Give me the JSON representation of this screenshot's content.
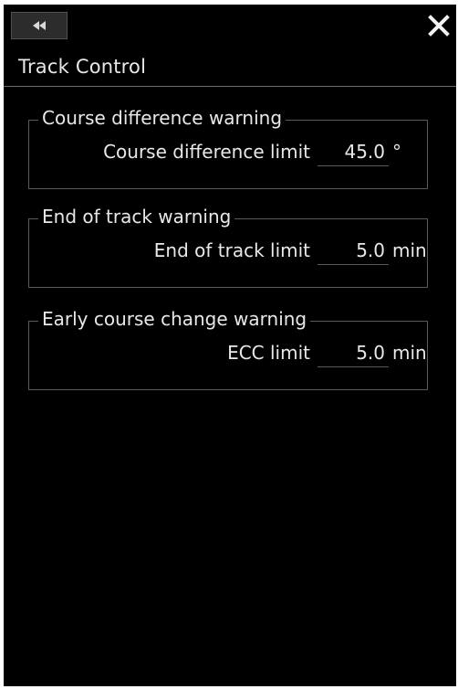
{
  "header": {
    "collapse_icon": "double-chevron-left-icon",
    "close_icon": "close-icon"
  },
  "panel": {
    "title": "Track Control"
  },
  "groups": [
    {
      "title": "Course difference warning",
      "field_label": "Course difference limit",
      "value": "45.0",
      "unit": "°"
    },
    {
      "title": "End of track warning",
      "field_label": "End of track limit",
      "value": "5.0",
      "unit": "min"
    },
    {
      "title": "Early course change warning",
      "field_label": "ECC limit",
      "value": "5.0",
      "unit": "min"
    }
  ],
  "colors": {
    "background": "#000000",
    "text": "#e8e8e8",
    "border": "#5a5a5a",
    "button_bg": "#2c2c2c"
  }
}
